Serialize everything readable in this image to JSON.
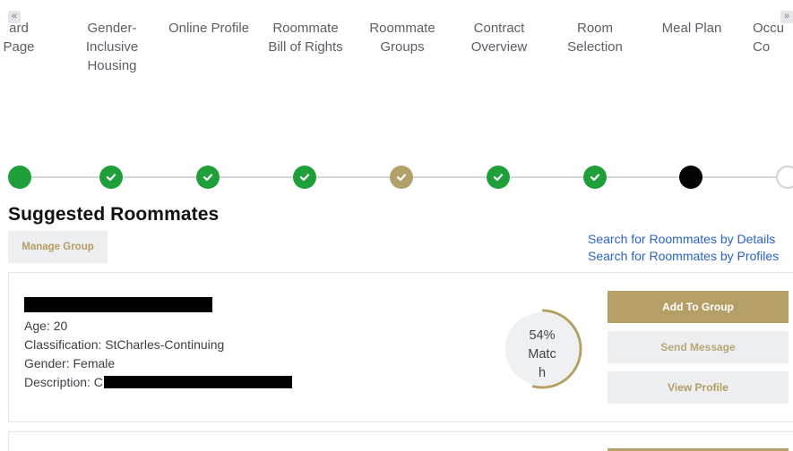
{
  "nav": {
    "scroll_left": "«",
    "scroll_right": "»",
    "steps": [
      {
        "label": "ard\nPage",
        "status": "complete"
      },
      {
        "label": "Gender-\nInclusive\nHousing",
        "status": "complete"
      },
      {
        "label": "Online Profile",
        "status": "complete"
      },
      {
        "label": "Roommate\nBill of Rights",
        "status": "complete"
      },
      {
        "label": "Roommate\nGroups",
        "status": "visited"
      },
      {
        "label": "Contract\nOverview",
        "status": "complete"
      },
      {
        "label": "Room\nSelection",
        "status": "complete"
      },
      {
        "label": "Meal Plan",
        "status": "current"
      },
      {
        "label": "Occu\nCo",
        "status": "pending"
      }
    ]
  },
  "section": {
    "title": "Suggested Roommates",
    "manage_group": "Manage Group",
    "search_details": "Search for Roommates by Details",
    "search_profiles": "Search for Roommates by Profiles"
  },
  "roommate": {
    "age": "Age: 20",
    "classification": "Classification: StCharles-Continuing",
    "gender": "Gender: Female",
    "description": "Description: C",
    "match_percent": 54,
    "match_label_1": "54%",
    "match_label_2": "Matc",
    "match_label_3": "h",
    "add_to_group": "Add To Group",
    "send_message": "Send Message",
    "view_profile": "View Profile"
  },
  "colors": {
    "complete": "#1f9f3a",
    "visited": "#b1a06a",
    "current": "#050505",
    "accent_gold": "#b4a067",
    "link_blue": "#2b63c6"
  }
}
